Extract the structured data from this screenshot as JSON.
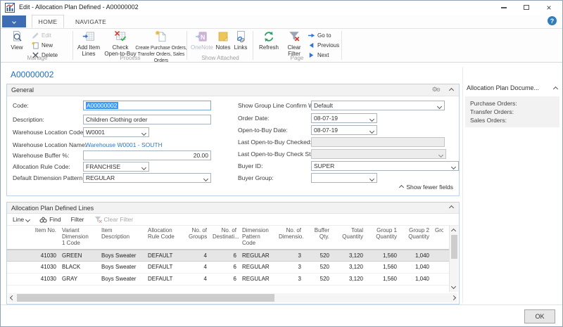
{
  "window": {
    "title": "Edit - Allocation Plan Defined - A00000002",
    "record_title": "A00000002",
    "help": "?",
    "ok_label": "OK"
  },
  "ribbon": {
    "tabs": {
      "home": "HOME",
      "navigate": "NAVIGATE"
    },
    "manage": {
      "label": "Manage",
      "view": "View",
      "edit": "Edit",
      "new": "New",
      "delete": "Delete"
    },
    "process": {
      "label": "Process",
      "add_item_lines": "Add Item\nLines",
      "check_open_to_buy": "Check\nOpen-to-Buy",
      "create_orders": "Create Purchase Orders,\nTransfer Orders, Sales Orders"
    },
    "show_attached": {
      "label": "Show Attached",
      "onenote": "OneNote",
      "notes": "Notes",
      "links": "Links"
    },
    "page": {
      "label": "Page",
      "refresh": "Refresh",
      "clear_filter": "Clear\nFilter",
      "goto": "Go to",
      "previous": "Previous",
      "next": "Next"
    }
  },
  "general": {
    "title": "General",
    "show_fewer": "Show fewer fields",
    "fields_left": [
      {
        "label": "Code:",
        "value": "A00000002"
      },
      {
        "label": "Description:",
        "value": "Children Clothing order"
      },
      {
        "label": "Warehouse Location Code:",
        "value": "W0001"
      },
      {
        "label": "Warehouse Location Name:",
        "value": "Warehouse W0001 - SOUTH"
      },
      {
        "label": "Warehouse Buffer %:",
        "value": "20.00"
      },
      {
        "label": "Allocation Rule Code:",
        "value": "FRANCHISE"
      },
      {
        "label": "Default Dimension Pattern:",
        "value": "REGULAR"
      }
    ],
    "fields_right": [
      {
        "label": "Show Group Line Confirm Warn.:",
        "value": "Default"
      },
      {
        "label": "Order Date:",
        "value": "08-07-19"
      },
      {
        "label": "Open-to-Buy Date:",
        "value": "08-07-19"
      },
      {
        "label": "Last Open-to-Buy Checked:",
        "value": ""
      },
      {
        "label": "Last Open-to-Buy Check Status:",
        "value": ""
      },
      {
        "label": "Buyer ID:",
        "value": "SUPER"
      },
      {
        "label": "Buyer Group:",
        "value": ""
      }
    ]
  },
  "factbox": {
    "title": "Allocation Plan Docume...",
    "items": [
      "Purchase Orders:",
      "Transfer Orders:",
      "Sales Orders:"
    ]
  },
  "lines": {
    "title": "Allocation Plan Defined Lines",
    "toolbar": {
      "line": "Line",
      "find": "Find",
      "filter": "Filter",
      "clear_filter": "Clear Filter"
    },
    "columns": [
      "Item No.",
      "Variant\nDimension\n1 Code",
      "Item\nDescription",
      "Allocation\nRule Code",
      "No. of\nGroups",
      "No. of\nDestinati...",
      "Dimension\nPattern\nCode",
      "No. of\nDimensio...",
      "Buffer\nQty.",
      "Total\nQuantity",
      "Group 1\nQuantity",
      "Group 2\nQuantity",
      "Group"
    ],
    "selected_row": 0,
    "rows": [
      [
        "41030",
        "GREEN",
        "Boys Sweater",
        "DEFAULT",
        "4",
        "6",
        "REGULAR",
        "3",
        "520",
        "3,120",
        "1,560",
        "1,040"
      ],
      [
        "41030",
        "BLACK",
        "Boys Sweater",
        "DEFAULT",
        "4",
        "6",
        "REGULAR",
        "3",
        "520",
        "3,120",
        "1,560",
        "1,040"
      ],
      [
        "41030",
        "GRAY",
        "Boys Sweater",
        "DEFAULT",
        "4",
        "6",
        "REGULAR",
        "3",
        "520",
        "3,120",
        "1,560",
        "1,040"
      ]
    ]
  },
  "colors": {
    "accent": "#3e6db5",
    "link": "#2e77c6",
    "selection": "#3399ff",
    "record_title": "#1b6ec2"
  }
}
